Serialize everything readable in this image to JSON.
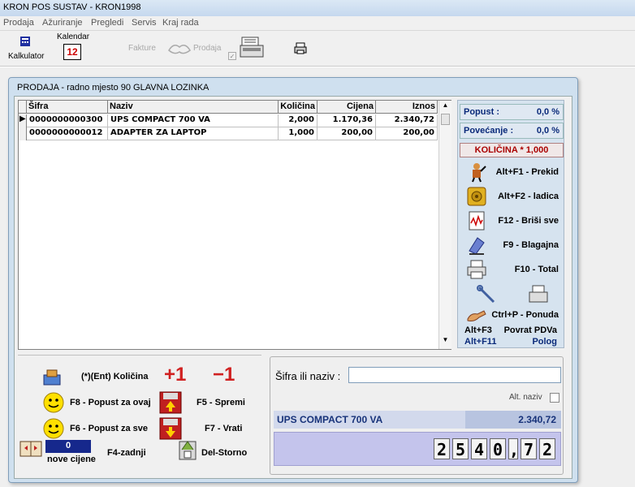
{
  "window_title": "KRON POS SUSTAV - KRON1998",
  "menu": [
    "Prodaja",
    "Ažuriranje",
    "Pregledi",
    "Servis",
    "Kraj rada"
  ],
  "toolbar": {
    "kalkulator": "Kalkulator",
    "kalendar": "Kalendar",
    "kalendar_icon_text": "12",
    "fakture": "Fakture",
    "prodaja": "Prodaja"
  },
  "sale_window": {
    "title": "PRODAJA - radno mjesto 90 GLAVNA LOZINKA",
    "columns": [
      "Šifra",
      "Naziv",
      "Količina",
      "Cijena",
      "Iznos"
    ],
    "rows": [
      {
        "sifra": "0000000000300",
        "naziv": "UPS COMPACT 700 VA",
        "kolicina": "2,000",
        "cijena": "1.170,36",
        "iznos": "2.340,72"
      },
      {
        "sifra": "0000000000012",
        "naziv": "ADAPTER ZA LAPTOP",
        "kolicina": "1,000",
        "cijena": "200,00",
        "iznos": "200,00"
      }
    ]
  },
  "right_panel": {
    "popust_label": "Popust :",
    "popust_value": "0,0 %",
    "povecanje_label": "Povećanje :",
    "povecanje_value": "0,0 %",
    "kolicina": "KOLIČINA * 1,000",
    "actions": [
      {
        "label": "Alt+F1 - Prekid",
        "icon": "stop-person-icon"
      },
      {
        "label": "Alt+F2 - ladica",
        "icon": "safe-icon"
      },
      {
        "label": "F12 - Briši sve",
        "icon": "delete-doc-icon"
      },
      {
        "label": "F9 - Blagajna",
        "icon": "register-icon"
      },
      {
        "label": "F10 - Total",
        "icon": "printer-icon"
      },
      {
        "label": "Ctrl+P - Ponuda",
        "icon": "hand-icon"
      }
    ],
    "povrat": {
      "key1": "Alt+F3",
      "label1": "Povrat PDVa",
      "key2": "Alt+F11",
      "label2": "Polog"
    }
  },
  "bottom_left": {
    "kolicina": "(*)(Ent) Količina",
    "plus": "+1",
    "minus": "−1",
    "f8": "F8 - Popust za ovaj",
    "f5": "F5 - Spremi",
    "f6": "F6 - Popust za sve",
    "f7": "F7 - Vrati",
    "counter": "0",
    "nove_cijene": "nove cijene",
    "f4": "F4-zadnji",
    "del": "Del-Storno"
  },
  "bottom_right": {
    "sifra_label": "Šifra ili naziv :",
    "sifra_value": "",
    "alt_naziv": "Alt. naziv",
    "item_name": "UPS COMPACT 700 VA",
    "item_price": "2.340,72",
    "total_digits": [
      "2",
      "5",
      "4",
      "0",
      ",",
      "7",
      "2"
    ]
  }
}
